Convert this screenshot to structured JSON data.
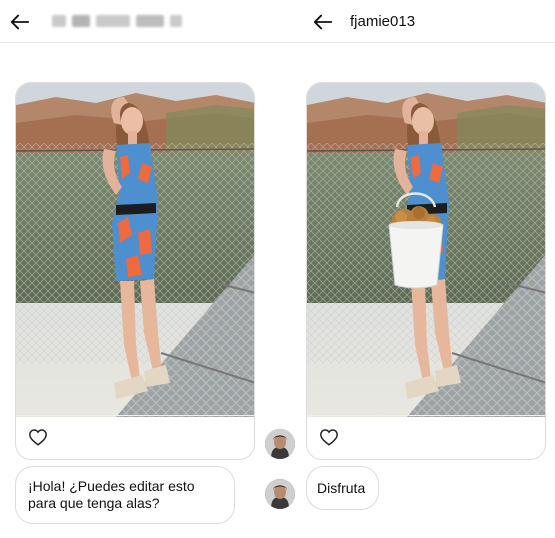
{
  "left_panel": {
    "header": {
      "back_icon": "arrow-left-icon",
      "username_redacted": true
    },
    "post": {
      "like_icon": "heart-outline-icon"
    },
    "message": {
      "text": "¡Hola! ¿Puedes editar esto para que tenga alas?"
    }
  },
  "right_panel": {
    "header": {
      "back_icon": "arrow-left-icon",
      "username": "fjamie013"
    },
    "post": {
      "like_icon": "heart-outline-icon"
    },
    "message": {
      "text": "Disfruta"
    }
  },
  "avatars": [
    "avatar-icon",
    "avatar-icon"
  ],
  "colors": {
    "text": "#111111",
    "border": "#dcdcdc",
    "background": "#ffffff"
  }
}
